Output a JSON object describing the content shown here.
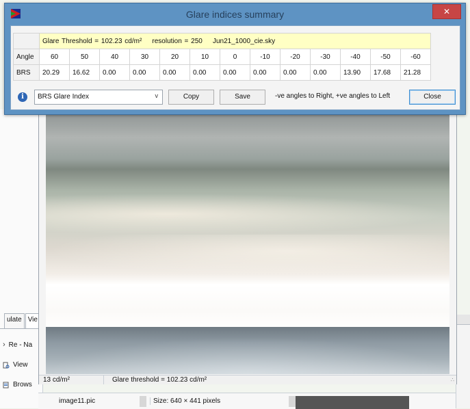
{
  "dialog": {
    "title": "Glare indices summary",
    "close_glyph": "✕",
    "info_line": {
      "threshold": "Glare Threshold = 102.23 cd/m²",
      "resolution": "resolution = 250",
      "sky": "Jun21_1000_cie.sky"
    },
    "angle_label": "Angle",
    "angles": [
      "60",
      "50",
      "40",
      "30",
      "20",
      "10",
      "0",
      "-10",
      "-20",
      "-30",
      "-40",
      "-50",
      "-60"
    ],
    "brs_label": "BRS",
    "brs_values": [
      "20.29",
      "16.62",
      "0.00",
      "0.00",
      "0.00",
      "0.00",
      "0.00",
      "0.00",
      "0.00",
      "0.00",
      "13.90",
      "17.68",
      "21.28"
    ],
    "index_select": "BRS Glare Index",
    "copy_label": "Copy",
    "save_label": "Save",
    "hint": "-ve angles to Right, +ve angles to Left",
    "close_label": "Close",
    "info_glyph": "i",
    "dropdown_glyph": "v"
  },
  "left_panel": {
    "tab1": "ulate",
    "tab2": "Vie",
    "item1": "Re - Na",
    "item2": "View",
    "item3": "Brows"
  },
  "image_window": {
    "status_left": "13 cd/m²",
    "status_threshold": "Glare threshold =  102.23 cd/m²",
    "grip": "∴"
  },
  "file_panel": {
    "file_name": "image11.pic",
    "size": "Size: 640 × 441 pixels"
  },
  "colors": {
    "title_bg": "#5e93c3",
    "info_bg": "#ffffc4",
    "close_red": "#c74545"
  },
  "icons": {
    "app": "app-flag-icon",
    "info": "info-icon",
    "close": "close-icon"
  }
}
